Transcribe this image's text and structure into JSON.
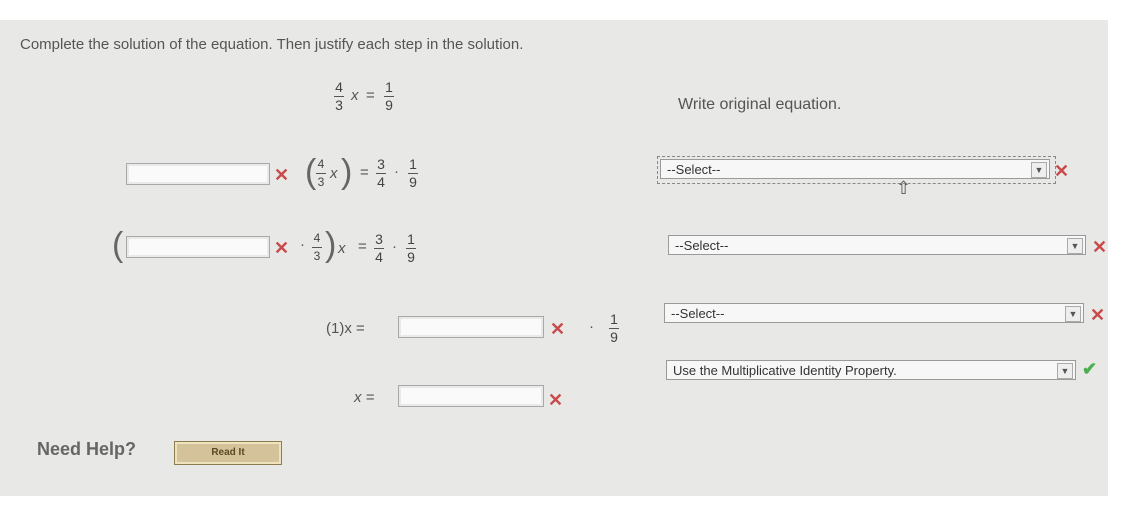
{
  "instructions": "Complete the solution of the equation. Then justify each step in the solution.",
  "equation": {
    "lhs_num": "4",
    "lhs_den": "3",
    "var": "x",
    "eq": "=",
    "rhs_num": "1",
    "rhs_den": "9"
  },
  "step1": {
    "frac_num": "4",
    "frac_den": "3",
    "var": "x",
    "eq": "=",
    "a_num": "3",
    "a_den": "4",
    "dot": "·",
    "b_num": "1",
    "b_den": "9"
  },
  "step2": {
    "dot": "·",
    "frac_num": "4",
    "frac_den": "3",
    "var": "x",
    "eq": "=",
    "a_num": "3",
    "a_den": "4",
    "dot2": "·",
    "b_num": "1",
    "b_den": "9"
  },
  "step3": {
    "lhs": "(1)x =",
    "dot": "·",
    "b_num": "1",
    "b_den": "9"
  },
  "step4": {
    "lhs": "x ="
  },
  "reasons": {
    "first": "Write original equation.",
    "select1": "--Select--",
    "select2": "--Select--",
    "select3": "--Select--",
    "select4": "Use the Multiplicative Identity Property."
  },
  "marks": {
    "wrong": "✕",
    "right": "✔"
  },
  "help": {
    "label": "Need Help?",
    "read_button": "Read It"
  }
}
